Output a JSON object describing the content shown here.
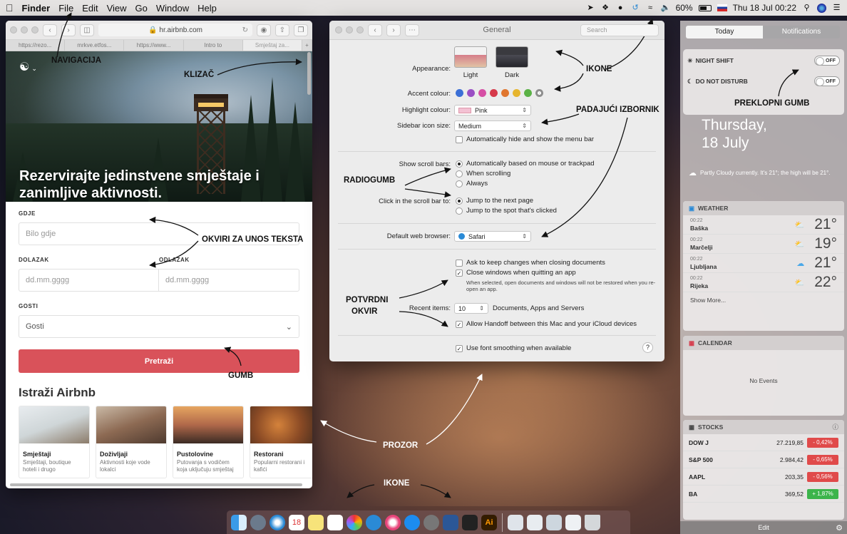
{
  "menubar": {
    "app_name": "Finder",
    "items": [
      "File",
      "Edit",
      "View",
      "Go",
      "Window",
      "Help"
    ],
    "battery": "60%",
    "datetime": "Thu 18 Jul 00:22"
  },
  "safari": {
    "address": "hr.airbnb.com",
    "tabs": [
      "https://rezo...",
      "mrkve.etfos...",
      "https://www...",
      "Intro to",
      "Smještaj za..."
    ],
    "hero_headline": "Rezervirajte jedinstvene smještaje i zanimljive aktivnosti.",
    "where_label": "GDJE",
    "where_placeholder": "Bilo gdje",
    "checkin_label": "DOLAZAK",
    "checkin_placeholder": "dd.mm.gggg",
    "checkout_label": "ODLAZAK",
    "checkout_placeholder": "dd.mm.gggg",
    "guests_label": "GOSTI",
    "guests_value": "Gosti",
    "search_label": "Pretraži",
    "explore_title": "Istraži Airbnb",
    "cards": [
      {
        "title": "Smještaji",
        "desc": "Smještaji, boutique hoteli i drugo"
      },
      {
        "title": "Doživljaji",
        "desc": "Aktivnosti koje vode lokalci"
      },
      {
        "title": "Pustolovine",
        "desc": "Putovanja s vodičem koja uključuju smještaj"
      },
      {
        "title": "Restorani",
        "desc": "Popularni restorani i kafići"
      }
    ]
  },
  "prefs": {
    "title": "General",
    "search_placeholder": "Search",
    "appearance_label": "Appearance:",
    "appearance_options": [
      "Light",
      "Dark"
    ],
    "accent_label": "Accent colour:",
    "accent_colors": [
      "#3b6fd6",
      "#9a4fc4",
      "#d64fa5",
      "#d6394a",
      "#e0762f",
      "#e6b52e",
      "#5bb246",
      "#8e8e8e"
    ],
    "highlight_label": "Highlight colour:",
    "highlight_value": "Pink",
    "sidebar_label": "Sidebar icon size:",
    "sidebar_value": "Medium",
    "autohide_label": "Automatically hide and show the menu bar",
    "scrollbars_label": "Show scroll bars:",
    "scrollbars_options": [
      "Automatically based on mouse or trackpad",
      "When scrolling",
      "Always"
    ],
    "click_label": "Click in the scroll bar to:",
    "click_options": [
      "Jump to the next page",
      "Jump to the spot that's clicked"
    ],
    "browser_label": "Default web browser:",
    "browser_value": "Safari",
    "ask_label": "Ask to keep changes when closing documents",
    "close_label": "Close windows when quitting an app",
    "close_note": "When selected, open documents and windows will not be restored when you re-open an app.",
    "recent_label": "Recent items:",
    "recent_value": "10",
    "recent_suffix": "Documents, Apps and Servers",
    "handoff_label": "Allow Handoff between this Mac and your iCloud devices",
    "smoothing_label": "Use font smoothing when available",
    "help": "?"
  },
  "nc": {
    "tab_today": "Today",
    "tab_notifications": "Notifications",
    "night_shift": "NIGHT SHIFT",
    "dnd": "DO NOT DISTURB",
    "off": "OFF",
    "day": "Thursday,",
    "date": "18 July",
    "forecast": "Partly Cloudy currently. It's 21°; the high will be 21°.",
    "weather_title": "WEATHER",
    "weather": [
      {
        "time": "00:22",
        "city": "Baška",
        "temp": "21°"
      },
      {
        "time": "00:22",
        "city": "Marčelji",
        "temp": "19°"
      },
      {
        "time": "00:22",
        "city": "Ljubljana",
        "temp": "21°"
      },
      {
        "time": "00:22",
        "city": "Rijeka",
        "temp": "22°"
      }
    ],
    "show_more": "Show More...",
    "calendar_title": "CALENDAR",
    "no_events": "No Events",
    "stocks_title": "STOCKS",
    "stocks": [
      {
        "sym": "DOW J",
        "price": "27.219,85",
        "chg": "- 0,42%",
        "color": "#e04a4a"
      },
      {
        "sym": "S&P 500",
        "price": "2.984,42",
        "chg": "- 0,65%",
        "color": "#e04a4a"
      },
      {
        "sym": "AAPL",
        "price": "203,35",
        "chg": "- 0,56%",
        "color": "#e04a4a"
      },
      {
        "sym": "BA",
        "price": "369,52",
        "chg": "+ 1,87%",
        "color": "#3cb44b"
      }
    ],
    "edit": "Edit"
  },
  "annotations": {
    "navigacija": "NAVIGACIJA",
    "klizac": "KLIZAČ",
    "ikone_top": "IKONE",
    "padajuci": "PADAJUĆI IZBORNIK",
    "preklopni": "PREKLOPNI GUMB",
    "radiogumb": "RADIOGUMB",
    "okviri": "OKVIRI ZA UNOS TEKSTA",
    "potvrdni_1": "POTVRDNI",
    "potvrdni_2": "OKVIR",
    "gumb": "GUMB",
    "prozor": "PROZOR",
    "ikone_bottom": "IKONE"
  }
}
